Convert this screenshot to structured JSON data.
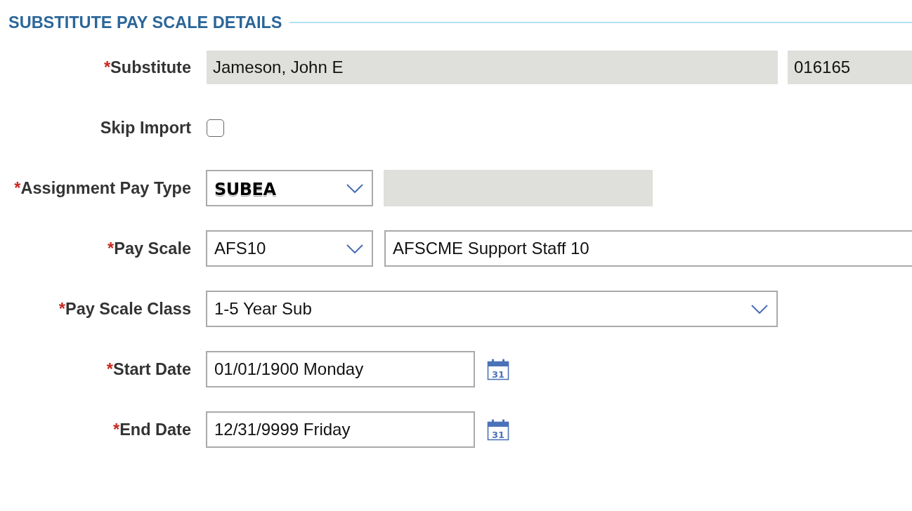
{
  "section": {
    "title": "SUBSTITUTE PAY SCALE DETAILS"
  },
  "fields": [
    {
      "kind": "readonly-pair",
      "required_mark": "*",
      "label": "Substitute",
      "value": "Jameson, John E",
      "code": "016165"
    },
    {
      "kind": "checkbox",
      "label": "Skip Import",
      "checked": false
    },
    {
      "kind": "select-with-readonly",
      "required_mark": "*",
      "label": "Assignment Pay Type",
      "value": "SUBEA"
    },
    {
      "kind": "select-with-text",
      "required_mark": "*",
      "label": "Pay Scale",
      "value": "AFS10",
      "description": "AFSCME Support Staff 10"
    },
    {
      "kind": "select",
      "required_mark": "*",
      "label": "Pay Scale Class",
      "value": "1-5 Year Sub"
    },
    {
      "kind": "date",
      "required_mark": "*",
      "label": "Start Date",
      "value": "01/01/1900 Monday",
      "calendar_icon_text": "31"
    },
    {
      "kind": "date",
      "required_mark": "*",
      "label": "End Date",
      "value": "12/31/9999 Friday",
      "calendar_icon_text": "31"
    }
  ]
}
